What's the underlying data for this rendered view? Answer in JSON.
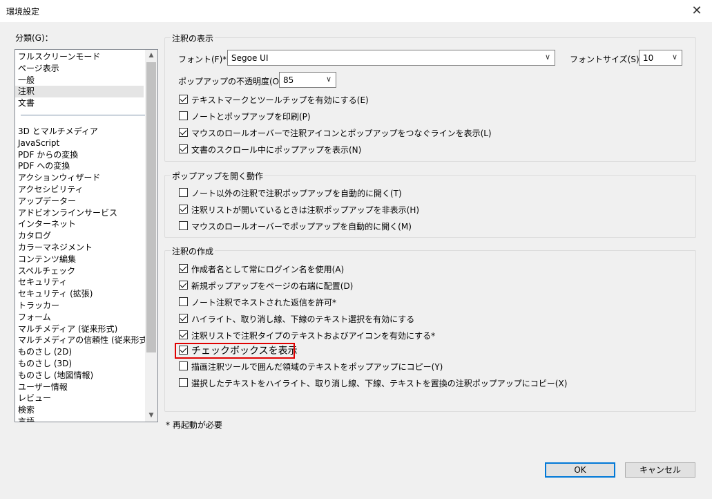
{
  "window": {
    "title": "環境設定",
    "close_glyph": "✕"
  },
  "categories": {
    "label": "分類(G)：",
    "items": [
      "フルスクリーンモード",
      "ページ表示",
      "一般",
      "注釈",
      "文書",
      "",
      "3D とマルチメディア",
      "JavaScript",
      "PDF からの変換",
      "PDF への変換",
      "アクションウィザード",
      "アクセシビリティ",
      "アップデーター",
      "アドビオンラインサービス",
      "インターネット",
      "カタログ",
      "カラーマネジメント",
      "コンテンツ編集",
      "スペルチェック",
      "セキュリティ",
      "セキュリティ (拡張)",
      "トラッカー",
      "フォーム",
      "マルチメディア (従来形式)",
      "マルチメディアの信頼性 (従来形式)",
      "ものさし (2D)",
      "ものさし (3D)",
      "ものさし (地図情報)",
      "ユーザー情報",
      "レビュー",
      "検索",
      "言語"
    ],
    "selected": "注釈"
  },
  "display": {
    "legend": "注釈の表示",
    "font_label": "フォント(F)*：",
    "font_value": "Segoe UI",
    "fontsize_label": "フォントサイズ(S)*：",
    "fontsize_value": "10",
    "opacity_label": "ポップアップの不透明度(O)：",
    "opacity_value": "85",
    "options": [
      {
        "label": "テキストマークとツールチップを有効にする(E)",
        "checked": true
      },
      {
        "label": "ノートとポップアップを印刷(P)",
        "checked": false
      },
      {
        "label": "マウスのロールオーバーで注釈アイコンとポップアップをつなぐラインを表示(L)",
        "checked": true
      },
      {
        "label": "文書のスクロール中にポップアップを表示(N)",
        "checked": true
      }
    ]
  },
  "popup": {
    "legend": "ポップアップを開く動作",
    "options": [
      {
        "label": "ノート以外の注釈で注釈ポップアップを自動的に開く(T)",
        "checked": false
      },
      {
        "label": "注釈リストが開いているときは注釈ポップアップを非表示(H)",
        "checked": true
      },
      {
        "label": "マウスのロールオーバーでポップアップを自動的に開く(M)",
        "checked": false
      }
    ]
  },
  "create": {
    "legend": "注釈の作成",
    "options": [
      {
        "label": "作成者名として常にログイン名を使用(A)",
        "checked": true
      },
      {
        "label": "新規ポップアップをページの右端に配置(D)",
        "checked": true
      },
      {
        "label": "ノート注釈でネストされた返信を許可*",
        "checked": false
      },
      {
        "label": "ハイライト、取り消し線、下線のテキスト選択を有効にする",
        "checked": true
      },
      {
        "label": "注釈リストで注釈タイプのテキストおよびアイコンを有効にする*",
        "checked": true
      },
      {
        "label": "チェックボックスを表示",
        "checked": true
      },
      {
        "label": "描画注釈ツールで囲んだ領域のテキストをポップアップにコピー(Y)",
        "checked": false
      },
      {
        "label": "選択したテキストをハイライト、取り消し線、下線、テキストを置換の注釈ポップアップにコピー(X)",
        "checked": false
      }
    ]
  },
  "footnote": "* 再起動が必要",
  "buttons": {
    "ok": "OK",
    "cancel": "キャンセル"
  },
  "colors": {
    "highlight": "#e00000",
    "default_button_border": "#0078d7"
  }
}
